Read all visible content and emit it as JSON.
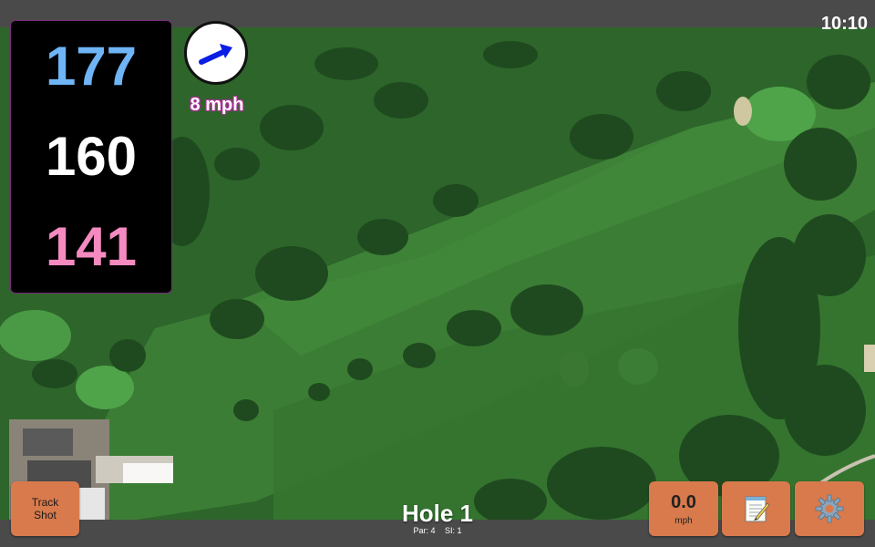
{
  "status": {
    "time": "10:10"
  },
  "distances": {
    "back": "177",
    "middle": "160",
    "front": "141"
  },
  "wind": {
    "speed_label": "8 mph",
    "arrow_icon": "wind-direction-arrow-icon"
  },
  "hole": {
    "title": "Hole 1",
    "par_label": "Par: 4",
    "si_label": "SI: 1"
  },
  "buttons": {
    "track_shot_line1": "Track",
    "track_shot_line2": "Shot",
    "speed_value": "0.0",
    "speed_unit": "mph",
    "notes_icon": "notepad-icon",
    "settings_icon": "gear-icon"
  },
  "colors": {
    "back_distance": "#6fb4f6",
    "middle_distance": "#ffffff",
    "front_distance": "#f48ac0",
    "button_bg": "#d87a4c",
    "wind_arrow": "#0a1ee6"
  }
}
